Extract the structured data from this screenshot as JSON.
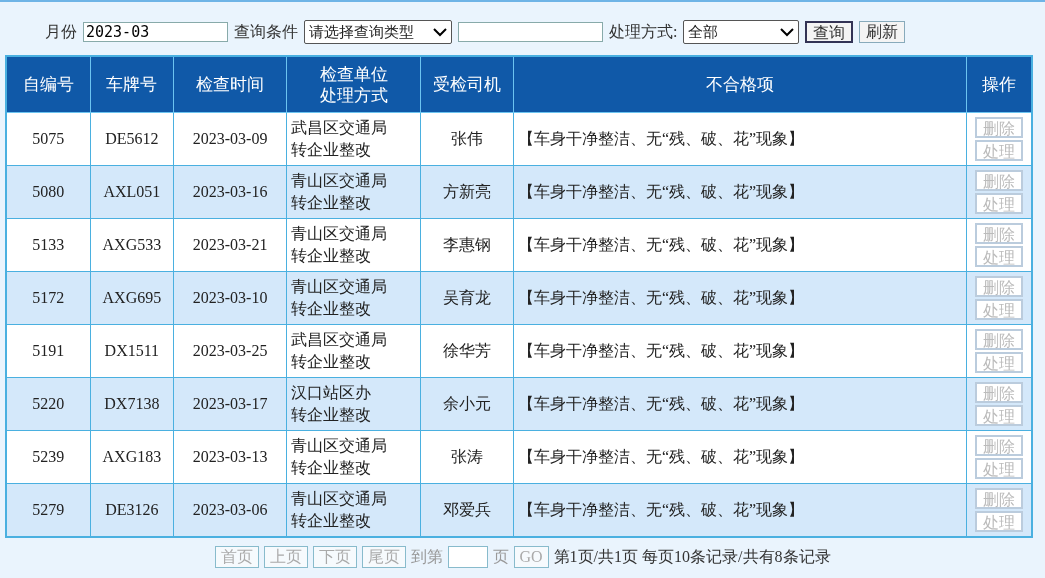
{
  "filters": {
    "month_label": "月份",
    "month_value": "2023-03",
    "query_label": "查询条件",
    "query_select": "请选择查询类型",
    "method_label": "处理方式:",
    "method_select": "全部",
    "buttons": [
      {
        "label": "查询",
        "disabled": false
      },
      {
        "label": "刷新",
        "disabled": false
      }
    ]
  },
  "table": {
    "columns": [
      [
        "自编号"
      ],
      [
        "车牌号"
      ],
      [
        "检查时间"
      ],
      [
        "检查单位",
        "处理方式"
      ],
      [
        "受检司机"
      ],
      [
        "不合格项"
      ],
      [
        "操作"
      ]
    ],
    "rows": [
      {
        "id": "5075",
        "plate": "DE5612",
        "date": "2023-03-09",
        "unit": "武昌区交通局",
        "method": "转企业整改",
        "driver": "张伟",
        "item": "【车身干净整洁、无“残、破、花”现象】",
        "actions": [
          {
            "label": "删除",
            "disabled": true
          },
          {
            "label": "处理",
            "disabled": true
          }
        ]
      },
      {
        "id": "5080",
        "plate": "AXL051",
        "date": "2023-03-16",
        "unit": "青山区交通局",
        "method": "转企业整改",
        "driver": "方新亮",
        "item": "【车身干净整洁、无“残、破、花”现象】",
        "actions": [
          {
            "label": "删除",
            "disabled": true
          },
          {
            "label": "处理",
            "disabled": true
          }
        ]
      },
      {
        "id": "5133",
        "plate": "AXG533",
        "date": "2023-03-21",
        "unit": "青山区交通局",
        "method": "转企业整改",
        "driver": "李惠钢",
        "item": "【车身干净整洁、无“残、破、花”现象】",
        "actions": [
          {
            "label": "删除",
            "disabled": true
          },
          {
            "label": "处理",
            "disabled": true
          }
        ]
      },
      {
        "id": "5172",
        "plate": "AXG695",
        "date": "2023-03-10",
        "unit": "青山区交通局",
        "method": "转企业整改",
        "driver": "吴育龙",
        "item": "【车身干净整洁、无“残、破、花”现象】",
        "actions": [
          {
            "label": "删除",
            "disabled": true
          },
          {
            "label": "处理",
            "disabled": true
          }
        ]
      },
      {
        "id": "5191",
        "plate": "DX1511",
        "date": "2023-03-25",
        "unit": "武昌区交通局",
        "method": "转企业整改",
        "driver": "徐华芳",
        "item": "【车身干净整洁、无“残、破、花”现象】",
        "actions": [
          {
            "label": "删除",
            "disabled": true
          },
          {
            "label": "处理",
            "disabled": true
          }
        ]
      },
      {
        "id": "5220",
        "plate": "DX7138",
        "date": "2023-03-17",
        "unit": "汉口站区办",
        "method": "转企业整改",
        "driver": "余小元",
        "item": "【车身干净整洁、无“残、破、花”现象】",
        "actions": [
          {
            "label": "删除",
            "disabled": true
          },
          {
            "label": "处理",
            "disabled": true
          }
        ]
      },
      {
        "id": "5239",
        "plate": "AXG183",
        "date": "2023-03-13",
        "unit": "青山区交通局",
        "method": "转企业整改",
        "driver": "张涛",
        "item": "【车身干净整洁、无“残、破、花”现象】",
        "actions": [
          {
            "label": "删除",
            "disabled": true
          },
          {
            "label": "处理",
            "disabled": true
          }
        ]
      },
      {
        "id": "5279",
        "plate": "DE3126",
        "date": "2023-03-06",
        "unit": "青山区交通局",
        "method": "转企业整改",
        "driver": "邓爱兵",
        "item": "【车身干净整洁、无“残、破、花”现象】",
        "actions": [
          {
            "label": "删除",
            "disabled": true
          },
          {
            "label": "处理",
            "disabled": true
          }
        ]
      }
    ]
  },
  "pagination": {
    "buttons": [
      {
        "label": "首页",
        "disabled": true
      },
      {
        "label": "上页",
        "disabled": true
      },
      {
        "label": "下页",
        "disabled": true
      },
      {
        "label": "尾页",
        "disabled": true
      }
    ],
    "goto_label": "到第",
    "page_unit": "页",
    "go_button": {
      "label": "GO",
      "disabled": true
    },
    "summary": "第1页/共1页 每页10条记录/共有8条记录"
  }
}
